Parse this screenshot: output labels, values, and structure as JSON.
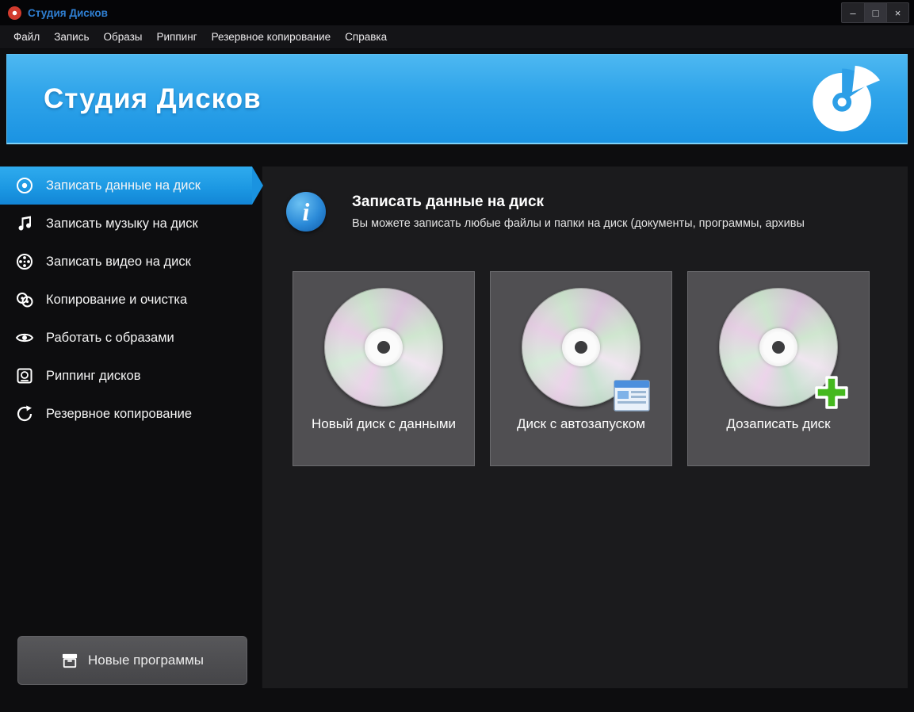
{
  "window": {
    "title": "Студия Дисков",
    "controls": {
      "minimize": "–",
      "maximize": "□",
      "close": "×"
    }
  },
  "menu": {
    "items": [
      "Файл",
      "Запись",
      "Образы",
      "Риппинг",
      "Резервное копирование",
      "Справка"
    ]
  },
  "banner": {
    "title": "Студия Дисков"
  },
  "sidebar": {
    "items": [
      {
        "label": "Записать данные на диск",
        "icon": "disc-record-icon",
        "active": true
      },
      {
        "label": "Записать музыку на диск",
        "icon": "music-note-icon",
        "active": false
      },
      {
        "label": "Записать видео на диск",
        "icon": "film-reel-icon",
        "active": false
      },
      {
        "label": "Копирование и очистка",
        "icon": "copy-discs-icon",
        "active": false
      },
      {
        "label": "Работать с образами",
        "icon": "eye-icon",
        "active": false
      },
      {
        "label": "Риппинг дисков",
        "icon": "disc-drive-icon",
        "active": false
      },
      {
        "label": "Резервное копирование",
        "icon": "backup-arrows-icon",
        "active": false
      }
    ],
    "footer_button": "Новые программы"
  },
  "main": {
    "heading": "Записать данные на диск",
    "description": "Вы можете записать любые файлы и папки на диск (документы, программы, архивы",
    "cards": [
      {
        "label": "Новый диск с данными",
        "overlay": "none"
      },
      {
        "label": "Диск с автозапуском",
        "overlay": "autorun-window-icon"
      },
      {
        "label": "Дозаписать диск",
        "overlay": "green-plus-icon"
      }
    ]
  },
  "colors": {
    "accent_blue": "#1b93e2",
    "banner_top": "#4db8f1",
    "titlebar_text": "#2f7fd2",
    "main_panel": "#1b1b1d",
    "card_bg": "#504f52",
    "plus_green": "#45b81e"
  }
}
